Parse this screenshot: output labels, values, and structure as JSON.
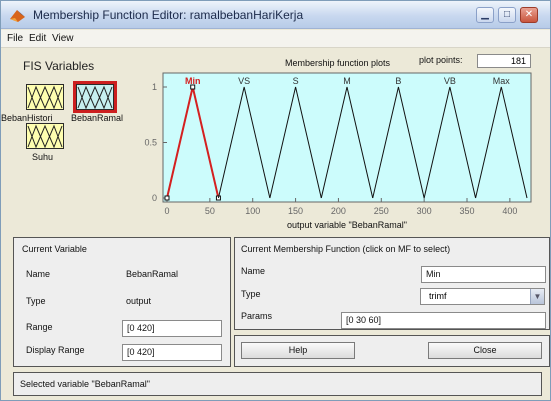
{
  "window": {
    "title": "Membership Function Editor: ramalbebanHariKerja"
  },
  "menu": {
    "items": [
      "File",
      "Edit",
      "View"
    ]
  },
  "fis": {
    "title": "FIS Variables",
    "variables": [
      {
        "label": "BebanHistori",
        "kind": "input"
      },
      {
        "label": "BebanRamal",
        "kind": "output"
      },
      {
        "label": "Suhu",
        "kind": "input"
      }
    ]
  },
  "plot": {
    "header": "Membership function plots",
    "points_label": "plot points:",
    "points_value": "181",
    "xlabel": "output variable \"BebanRamal\""
  },
  "chart_data": {
    "type": "line",
    "xlim": [
      0,
      420
    ],
    "ylim": [
      0,
      1
    ],
    "xticks": [
      0,
      50,
      100,
      150,
      200,
      250,
      300,
      350,
      400
    ],
    "yticks": [
      0,
      0.5,
      1
    ],
    "xlabel": "output variable \"BebanRamal\"",
    "grid": false,
    "selected": "Min",
    "series": [
      {
        "name": "Min",
        "params": [
          0,
          30,
          60
        ]
      },
      {
        "name": "VS",
        "params": [
          60,
          90,
          120
        ]
      },
      {
        "name": "S",
        "params": [
          120,
          150,
          180
        ]
      },
      {
        "name": "M",
        "params": [
          180,
          210,
          240
        ]
      },
      {
        "name": "B",
        "params": [
          240,
          270,
          300
        ]
      },
      {
        "name": "VB",
        "params": [
          300,
          330,
          360
        ]
      },
      {
        "name": "Max",
        "params": [
          360,
          390,
          420
        ]
      }
    ],
    "colors": {
      "selected": "#d42020",
      "normal": "#111111",
      "background": "#ccfcfc"
    }
  },
  "current_variable": {
    "title": "Current Variable",
    "name_label": "Name",
    "name_value": "BebanRamal",
    "type_label": "Type",
    "type_value": "output",
    "range_label": "Range",
    "range_value": "[0 420]",
    "display_range_label": "Display Range",
    "display_range_value": "[0 420]"
  },
  "current_mf": {
    "title": "Current Membership Function (click on MF to select)",
    "name_label": "Name",
    "name_value": "Min",
    "type_label": "Type",
    "type_value": "trimf",
    "params_label": "Params",
    "params_value": "[0 30 60]"
  },
  "buttons": {
    "help": "Help",
    "close": "Close"
  },
  "status": "Selected variable \"BebanRamal\""
}
